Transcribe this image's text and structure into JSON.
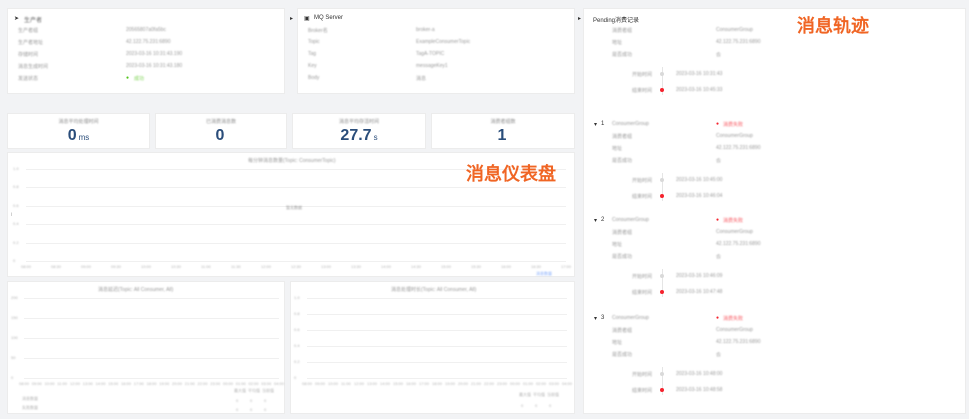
{
  "producer": {
    "title": "生产者",
    "rows": [
      {
        "k": "生产者组",
        "v": "20565807a0fa5bc"
      },
      {
        "k": "生产者地址",
        "v": "42.122.75.231:6890"
      },
      {
        "k": "存储时间",
        "v": "2023-03-16 10:31:43.190"
      },
      {
        "k": "消息生成时间",
        "v": "2023-03-16 10:31:43.180"
      },
      {
        "k": "发送状态",
        "v": "成功"
      }
    ]
  },
  "mq": {
    "title": "MQ Server",
    "rows": [
      {
        "k": "Broker名",
        "v": "broker-a"
      },
      {
        "k": "Topic",
        "v": "ExampleConsumerTopic"
      },
      {
        "k": "Tag",
        "v": "TagA-TOPIC"
      },
      {
        "k": "Key",
        "v": "messageKey1"
      },
      {
        "k": "Body",
        "v": "消息"
      }
    ]
  },
  "stats": [
    {
      "title": "消息平均处理时间",
      "value": "0",
      "unit": "ms"
    },
    {
      "title": "已消费消息数",
      "value": "0",
      "unit": ""
    },
    {
      "title": "消息平均存活时间",
      "value": "27.7",
      "unit": "s"
    },
    {
      "title": "消费者组数",
      "value": "1",
      "unit": ""
    }
  ],
  "main_chart": {
    "title": "每分钟消息数量(Topic: ConsumerTopic)",
    "no_data": "暂无数据",
    "legend": "消息数量",
    "y_ticks": [
      "1.0",
      "0.8",
      "0.6",
      "0.4",
      "0.2",
      "0"
    ],
    "x_ticks": [
      "08:00",
      "08:30",
      "09:00",
      "09:30",
      "10:00",
      "10:30",
      "11:00",
      "11:30",
      "12:00",
      "12:30",
      "13:00",
      "13:30",
      "14:00",
      "14:30",
      "15:00",
      "15:30",
      "16:00",
      "16:30",
      "17:00"
    ]
  },
  "bl_chart": {
    "title": "消息延迟(Topic: All Consumer, All)",
    "y_ticks": [
      "200",
      "150",
      "100",
      "50",
      "0"
    ],
    "x_ticks": [
      "08:00",
      "09:00",
      "10:00",
      "11:00",
      "12:00",
      "13:00",
      "14:00",
      "15:00",
      "16:00",
      "17:00",
      "18:00",
      "19:00",
      "20:00",
      "21:00",
      "22:00",
      "23:00",
      "00:00",
      "01:00",
      "02:00",
      "03:00",
      "04:00"
    ],
    "legend_left": [
      "消息数量",
      "失败数量"
    ],
    "legend_right": [
      "最大值",
      "平均值",
      "当前值"
    ]
  },
  "br_chart": {
    "title": "消息处理时长(Topic: All Consumer, All)",
    "y_ticks": [
      "1.0",
      "0.8",
      "0.6",
      "0.4",
      "0.2",
      "0"
    ],
    "x_ticks": [
      "08:00",
      "09:00",
      "10:00",
      "11:00",
      "12:00",
      "13:00",
      "14:00",
      "15:00",
      "16:00",
      "17:00",
      "18:00",
      "19:00",
      "20:00",
      "21:00",
      "22:00",
      "23:00",
      "00:00",
      "01:00",
      "02:00",
      "03:00",
      "04:00"
    ],
    "legend_right": [
      "最大值",
      "平均值",
      "当前值"
    ]
  },
  "trace": {
    "title": "Pending消费记录",
    "overlay": "消息轨迹",
    "entries": [
      {
        "num": "",
        "status": "",
        "ip": "42.122.75.231:6890",
        "result": "否",
        "t1": "2023-03-16 10:31:43",
        "t2": "2023-03-16 10:45:33"
      },
      {
        "num": "1",
        "status": "消费失败",
        "ip": "42.122.75.231:6890",
        "result": "否",
        "t1": "2023-03-16 10:45:00",
        "t2": "2023-03-16 10:46:04"
      },
      {
        "num": "2",
        "status": "消费失败",
        "ip": "42.122.75.231:6890",
        "result": "否",
        "t1": "2023-03-16 10:46:09",
        "t2": "2023-03-16 10:47:48"
      },
      {
        "num": "3",
        "status": "消费失败",
        "ip": "42.122.75.231:6890",
        "result": "否",
        "t1": "2023-03-16 10:48:00",
        "t2": "2023-03-16 10:48:58"
      }
    ]
  },
  "overlay_dash": "消息仪表盘"
}
